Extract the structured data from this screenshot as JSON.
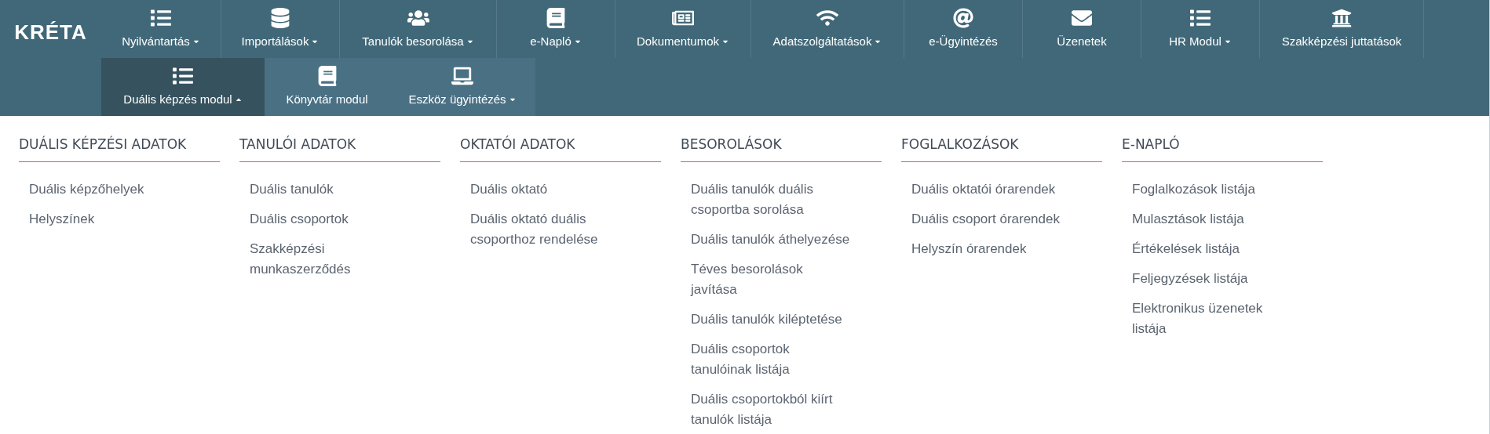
{
  "logo": {
    "text": "KRÉTA"
  },
  "nav_rows": [
    {
      "items": [
        {
          "label": "Nyilvántartás",
          "has_menu": true,
          "selected": false
        },
        {
          "label": "Importálások",
          "has_menu": true,
          "selected": false
        },
        {
          "label": "Tanulók besorolása",
          "has_menu": true,
          "selected": false
        },
        {
          "label": "e-Napló",
          "has_menu": true,
          "selected": false
        },
        {
          "label": "Dokumentumok",
          "has_menu": true,
          "selected": false
        },
        {
          "label": "Adatszolgáltatások",
          "has_menu": true,
          "selected": false
        },
        {
          "label": "e-Ügyintézés",
          "has_menu": false,
          "selected": false
        },
        {
          "label": "Üzenetek",
          "has_menu": false,
          "selected": false
        },
        {
          "label": "HR Modul",
          "has_menu": true,
          "selected": false
        },
        {
          "label": "Szakképzési juttatások",
          "has_menu": false,
          "selected": false
        }
      ]
    },
    {
      "items": [
        {
          "label": "Duális képzés modul",
          "has_menu": true,
          "selected": true
        },
        {
          "label": "Könyvtár modul",
          "has_menu": false,
          "selected": false
        },
        {
          "label": "Eszköz ügyintézés",
          "has_menu": true,
          "selected": false
        }
      ]
    }
  ],
  "menu_columns": [
    {
      "heading": "DUÁLIS KÉPZÉSI ADATOK",
      "links": [
        "Duális képzőhelyek",
        "Helyszínek"
      ]
    },
    {
      "heading": "TANULÓI ADATOK",
      "links": [
        "Duális tanulók",
        "Duális csoportok",
        "Szakképzési munkaszerződés"
      ]
    },
    {
      "heading": "OKTATÓI ADATOK",
      "links": [
        "Duális oktató",
        "Duális oktató duális csoporthoz rendelése"
      ]
    },
    {
      "heading": "BESOROLÁSOK",
      "links": [
        "Duális tanulók duális csoportba sorolása",
        "Duális tanulók áthelyezése",
        "Téves besorolások javítása",
        "Duális tanulók kiléptetése",
        "Duális csoportok tanulóinak listája",
        "Duális csoportokból kiírt tanulók listája"
      ]
    },
    {
      "heading": "FOGLALKOZÁSOK",
      "links": [
        "Duális oktatói órarendek",
        "Duális csoport órarendek",
        "Helyszín órarendek"
      ]
    },
    {
      "heading": "E-NAPLÓ",
      "links": [
        "Foglalkozások listája",
        "Mulasztások listája",
        "Értékelések listája",
        "Feljegyzések listája",
        "Elektronikus üzenetek listája"
      ]
    }
  ]
}
